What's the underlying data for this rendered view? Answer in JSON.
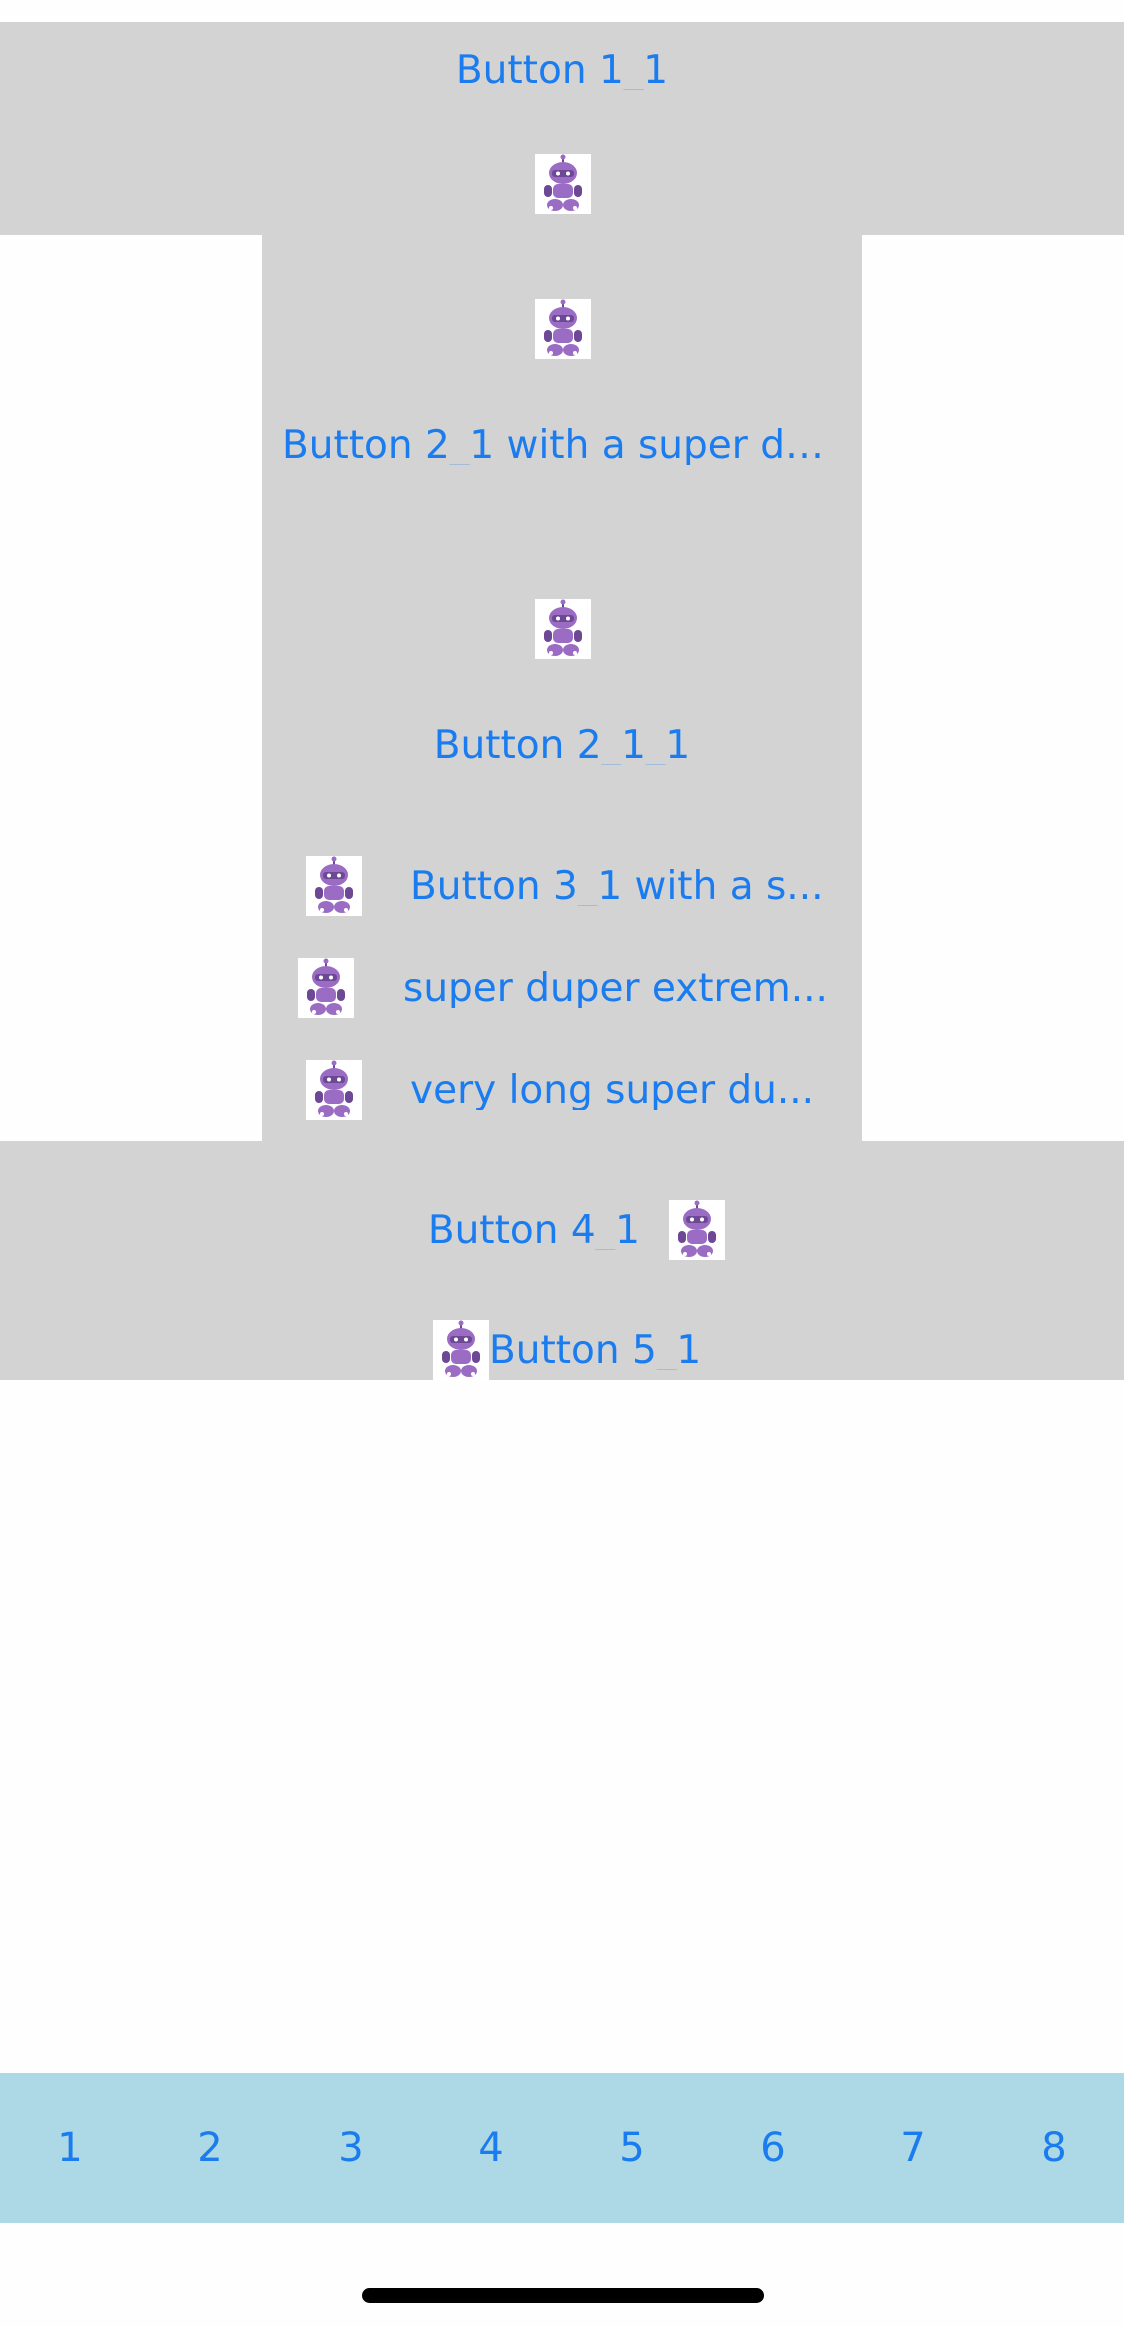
{
  "colors": {
    "background": "#fefefe",
    "panel": "#d3d3d3",
    "link_text": "#1a7cef",
    "tab_bar": "#add8e6",
    "icon_primary": "#9b6cc3",
    "icon_shadow": "#6d4895",
    "home_indicator": "#000000"
  },
  "icons": {
    "robot": "robot-mascot-icon"
  },
  "buttons": {
    "b1_1": "Button 1_1",
    "b2_1": "Button 2_1 with a super du...",
    "b2_1_1": "Button 2_1_1",
    "b3_1": "Button 3_1 with a s...",
    "b3_2": "super duper extrem...",
    "b3_3": "very long super du...",
    "b4_1": "Button 4_1",
    "b5_1": "Button 5_1"
  },
  "tabs": [
    "1",
    "2",
    "3",
    "4",
    "5",
    "6",
    "7",
    "8"
  ]
}
